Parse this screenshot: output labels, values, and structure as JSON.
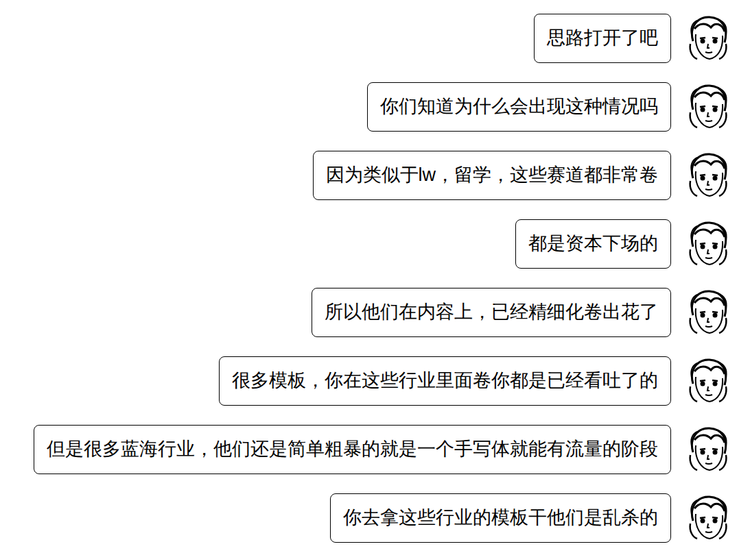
{
  "messages": [
    {
      "text": "思路打开了吧"
    },
    {
      "text": "你们知道为什么会出现这种情况吗"
    },
    {
      "text": "因为类似于lw，留学，这些赛道都非常卷"
    },
    {
      "text": "都是资本下场的"
    },
    {
      "text": "所以他们在内容上，已经精细化卷出花了"
    },
    {
      "text": "很多模板，你在这些行业里面卷你都是已经看吐了的"
    },
    {
      "text": "但是很多蓝海行业，他们还是简单粗暴的就是一个手写体就能有流量的阶段"
    },
    {
      "text": "你去拿这些行业的模板干他们是乱杀的"
    }
  ]
}
